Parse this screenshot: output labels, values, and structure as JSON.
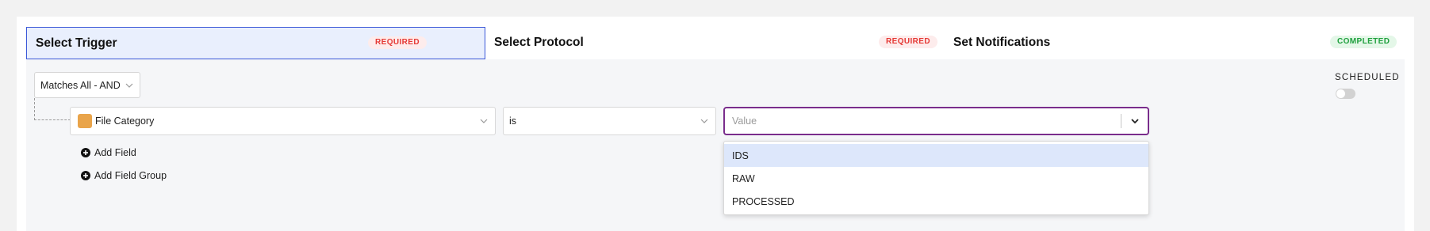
{
  "steps": [
    {
      "title": "Select Trigger",
      "badge": "REQUIRED",
      "active": true
    },
    {
      "title": "Select Protocol",
      "badge": "REQUIRED",
      "active": false
    },
    {
      "title": "Set Notifications",
      "badge": "COMPLETED",
      "active": false
    }
  ],
  "condition_group": {
    "mode_label": "Matches All - AND"
  },
  "rule": {
    "field": {
      "label": "File Category",
      "icon": "category-color-swatch",
      "color": "#e9a44a"
    },
    "operator": {
      "label": "is"
    },
    "value": {
      "placeholder": "Value",
      "options": [
        "IDS",
        "RAW",
        "PROCESSED"
      ],
      "highlighted": "IDS"
    }
  },
  "actions": {
    "add_field": "Add Field",
    "add_field_group": "Add Field Group"
  },
  "schedule": {
    "label": "SCHEDULED",
    "enabled": false
  },
  "colors": {
    "accent": "#3a57d8",
    "focus": "#7a2d8c",
    "required": "#e53935",
    "completed": "#1fa03e"
  }
}
